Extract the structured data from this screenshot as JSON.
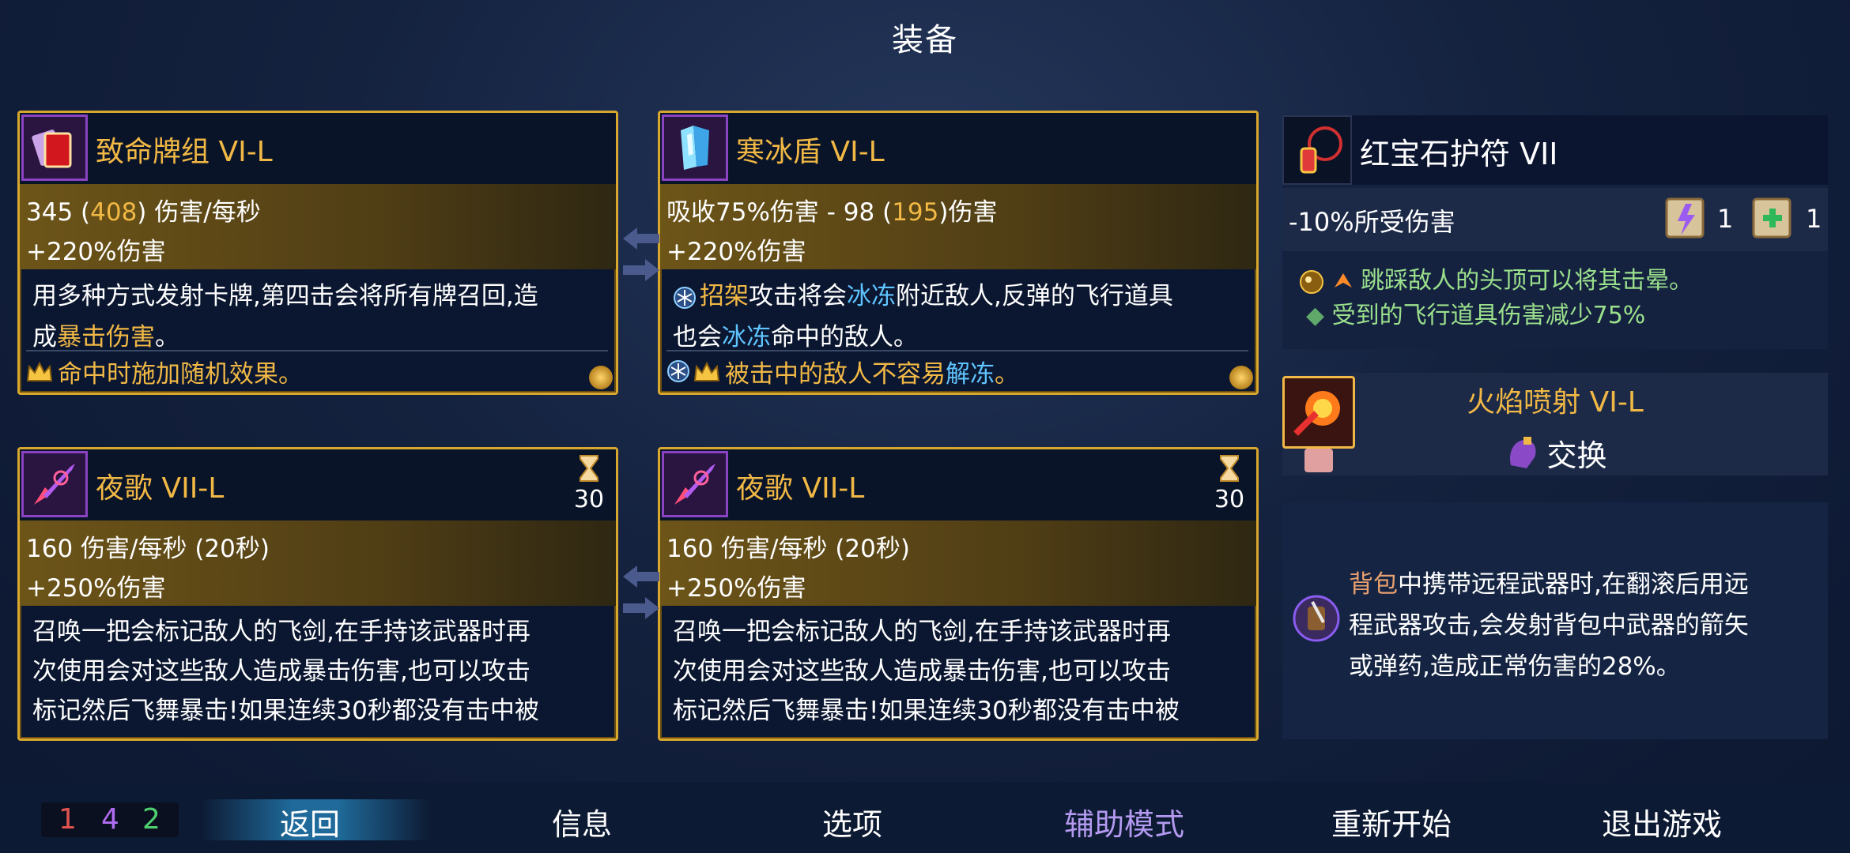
{
  "title": "装备",
  "cards": [
    {
      "name": "致命牌组 VI-L",
      "stat1_prefix": "345 (",
      "stat1_value": "408",
      "stat1_suffix": ") 伤害/每秒",
      "stat2": "+220%伤害",
      "desc1": "用多种方式发射卡牌,第四击会将所有牌召回,造",
      "desc2_a": "成",
      "desc2_b": "暴击伤害",
      "desc2_c": "。",
      "legend": "命中时施加随机效果。"
    },
    {
      "name": "寒冰盾 VI-L",
      "stat1_prefix": "吸收75%伤害 - 98 (",
      "stat1_value": "195",
      "stat1_suffix": ")伤害",
      "stat2": "+220%伤害",
      "desc1_a": "招架",
      "desc1_b": "攻击将会",
      "desc1_c": "冰冻",
      "desc1_d": "附近敌人,反弹的飞行道具",
      "desc2_a": "也会",
      "desc2_b": "冰冻",
      "desc2_c": "命中的敌人。",
      "legend_a": "被击中的敌人不容易",
      "legend_b": "解冻",
      "legend_c": "。"
    },
    {
      "name": "夜歌 VII-L",
      "timer": "30",
      "stat1": "160 伤害/每秒 (20秒)",
      "stat2": "+250%伤害",
      "desc1": "召唤一把会标记敌人的飞剑,在手持该武器时再",
      "desc2": "次使用会对这些敌人造成暴击伤害,也可以攻击",
      "desc3": "标记然后飞舞暴击!如果连续30秒都没有击中被"
    },
    {
      "name": "夜歌 VII-L",
      "timer": "30",
      "stat1": "160 伤害/每秒 (20秒)",
      "stat2": "+250%伤害",
      "desc1": "召唤一把会标记敌人的飞剑,在手持该武器时再",
      "desc2": "次使用会对这些敌人造成暴击伤害,也可以攻击",
      "desc3": "标记然后飞舞暴击!如果连续30秒都没有击中被"
    }
  ],
  "amulet": {
    "name": "红宝石护符 VII",
    "stat": "-10%所受伤害",
    "scroll1_count": "1",
    "scroll2_count": "1",
    "bullet1": "跳踩敌人的头顶可以将其击晕。",
    "bullet2": "受到的飞行道具伤害减少75%"
  },
  "swap": {
    "name": "火焰喷射 VI-L",
    "action": "交换"
  },
  "mutation": {
    "desc1_a": "背包",
    "desc1_b": "中携带远程武器时,在翻滚后用远",
    "desc2": "程武器攻击,会发射背包中武器的箭矢",
    "desc3": "或弹药,造成正常伤害的28%。"
  },
  "scrolls": {
    "brutality": "1",
    "tactics": "4",
    "survival": "2"
  },
  "colors": {
    "brutality": "#e0524f",
    "tactics": "#b06cf0",
    "survival": "#4fd06e",
    "gold": "#f1b845",
    "assist": "#b39af0"
  },
  "nav": {
    "back": "返回",
    "info": "信息",
    "options": "选项",
    "assist": "辅助模式",
    "restart": "重新开始",
    "quit": "退出游戏"
  }
}
